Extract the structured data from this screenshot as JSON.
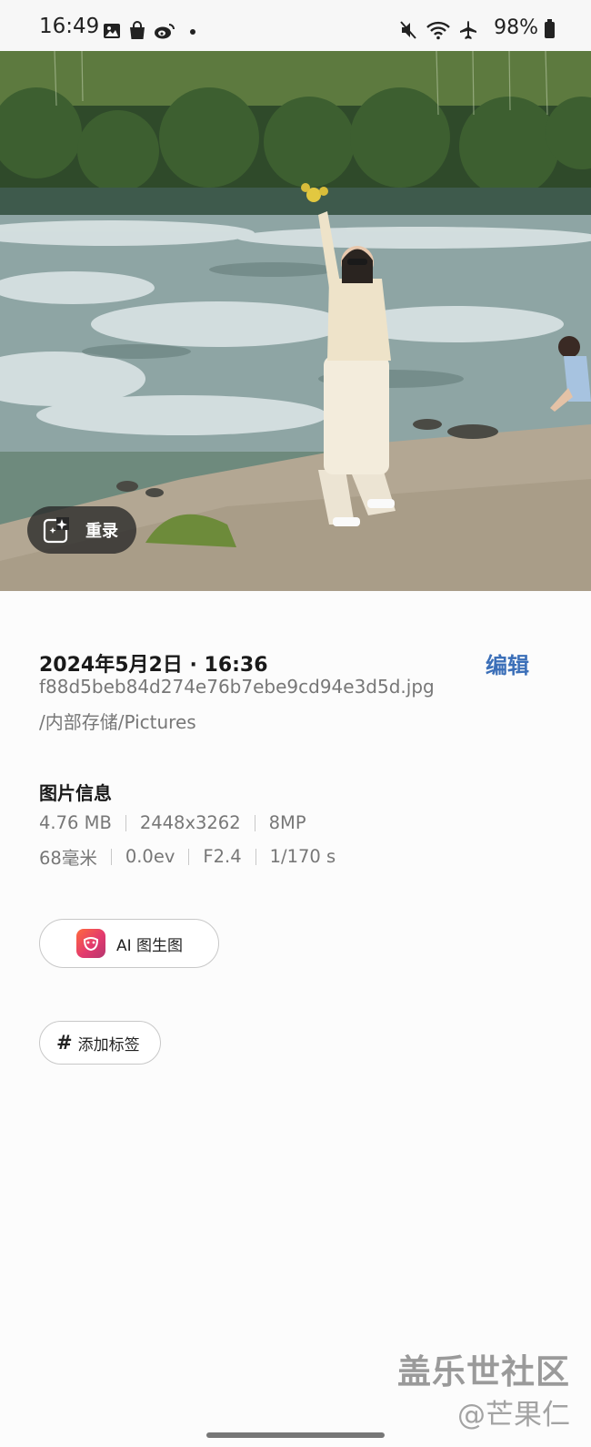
{
  "status_bar": {
    "time": "16:49",
    "left_icons": [
      "gallery-icon",
      "shopping-bag-icon",
      "weibo-icon",
      "dot-icon"
    ],
    "right_icons": [
      "mute-icon",
      "wifi-icon",
      "airplane-icon"
    ],
    "battery": "98%"
  },
  "photo": {
    "remaster_label": "重录"
  },
  "details": {
    "datetime": "2024年5月2日 · 16:36",
    "edit_label": "编辑",
    "filename": "f88d5beb84d274e76b7ebe9cd94e3d5d.jpg",
    "path": "/内部存储/Pictures"
  },
  "image_info": {
    "title": "图片信息",
    "row1": [
      "4.76 MB",
      "2448x3262",
      "8MP"
    ],
    "row2": [
      "68毫米",
      "0.0ev",
      "F2.4",
      "1/170 s"
    ]
  },
  "actions": {
    "ai_label": "AI 图生图",
    "tag_label": "添加标签",
    "tag_hash": "#"
  },
  "watermark": {
    "line1": "盖乐世社区",
    "line2": "@芒果仁"
  },
  "colors": {
    "accent": "#3b6fb8",
    "secondary_text": "#777777",
    "ai_icon_gradient_start": "#ff6a3d",
    "ai_icon_gradient_end": "#b5366f"
  }
}
